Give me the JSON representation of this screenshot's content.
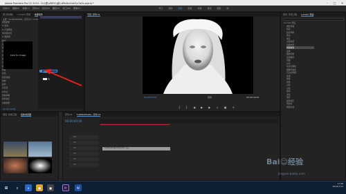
{
  "window": {
    "title": "Adobe Premiere Pro CC 2019 - D:\\\\视\\u9891\\\\影\\u89c6\\u5de5\\u7a0b.prproj *"
  },
  "menubar": [
    "文件(F)",
    "编辑(E)",
    "剪辑(C)",
    "序列(S)",
    "标记(M)",
    "图形(G)",
    "窗口(W)",
    "帮助(H)"
  ],
  "workspace_tabs": [
    "学习",
    "组件",
    "编辑",
    "颜色",
    "效果",
    "音频",
    "图形",
    "库"
  ],
  "effect_controls": {
    "tabs": [
      "源:(无剪辑)",
      "Lumetri 范围",
      "效果控件"
    ],
    "clip_title": "主要 * 5d4f6b2f0a8e...序列 01 * 5d4f...",
    "rows": [
      {
        "label": "视频效果",
        "value": ""
      },
      {
        "label": "fx 运动",
        "value": ""
      },
      {
        "label": "fx 不透明度",
        "value": ""
      },
      {
        "label": "时间重映射",
        "value": ""
      },
      {
        "label": "fx 超级键",
        "value": ""
      },
      {
        "label": "输出",
        "value": "合成"
      },
      {
        "label": "设置",
        "value": "自定义"
      },
      {
        "label": "安全边距",
        "value": ""
      },
      {
        "label": "色容差",
        "value": "0.0"
      },
      {
        "label": "遮罩生成",
        "value": ""
      },
      {
        "label": "透明度",
        "value": "45.0"
      },
      {
        "label": "高光",
        "value": "10.0"
      },
      {
        "label": "阴影",
        "value": "50.0"
      },
      {
        "label": "容差",
        "value": "50.0"
      },
      {
        "label": "基值",
        "value": "10.0"
      },
      {
        "label": "遮罩清除",
        "value": ""
      },
      {
        "label": "抑制",
        "value": "0.0"
      },
      {
        "label": "柔化",
        "value": "0.0"
      },
      {
        "label": "对比度",
        "value": "0.0"
      },
      {
        "label": "中间点",
        "value": "50.0"
      },
      {
        "label": "溅落抑制",
        "value": ""
      },
      {
        "label": "颜色校正",
        "value": ""
      },
      {
        "label": "音频效果",
        "value": ""
      }
    ],
    "thumb_text": "Click for Image",
    "output_dropdown": "合成",
    "timecode": "00:00:00:00"
  },
  "program": {
    "tab": "节目: 序列 01",
    "timecode_left": "00:00:00:00",
    "fit": "完整",
    "timecode_right": "00:00:09:00"
  },
  "project": {
    "tabs": [
      "项目: 影视工程",
      "Lumetri 预设"
    ],
    "items": [
      "Lumetri 预设",
      "电影风格",
      "色彩",
      "胶片风格",
      "黑白",
      "渐变",
      "过渡效果",
      "音频效果",
      "视频效果",
      "变换",
      "图像控制",
      "实用程序",
      "扭曲",
      "时间",
      "杂色与颗粒",
      "模糊与锐化",
      "沉浸式视频",
      "生成",
      "视频",
      "调整",
      "过时",
      "过渡",
      "透视",
      "通道",
      "键控",
      "颜色校正",
      "风格化",
      "视频过渡"
    ],
    "selected_index": 8
  },
  "media_browser": {
    "tabs": [
      "项目: 影视工程",
      "媒体浏览器"
    ]
  },
  "timeline": {
    "tabs": [
      "序列 01",
      "5d4f6b2f0a8e...序列 01"
    ],
    "timecode": "00:00:00:00",
    "clip_name": "5d4f6b2f0a8e7f2b0c5f3...jpg",
    "tracks": [
      "V3",
      "V2",
      "V1",
      "A1",
      "A2",
      "A3"
    ]
  },
  "taskbar": {
    "time": "17:08",
    "date": "2019/7/13"
  },
  "watermark": {
    "logo": "Bai☺经验",
    "url": "jingyan.baidu.com"
  }
}
